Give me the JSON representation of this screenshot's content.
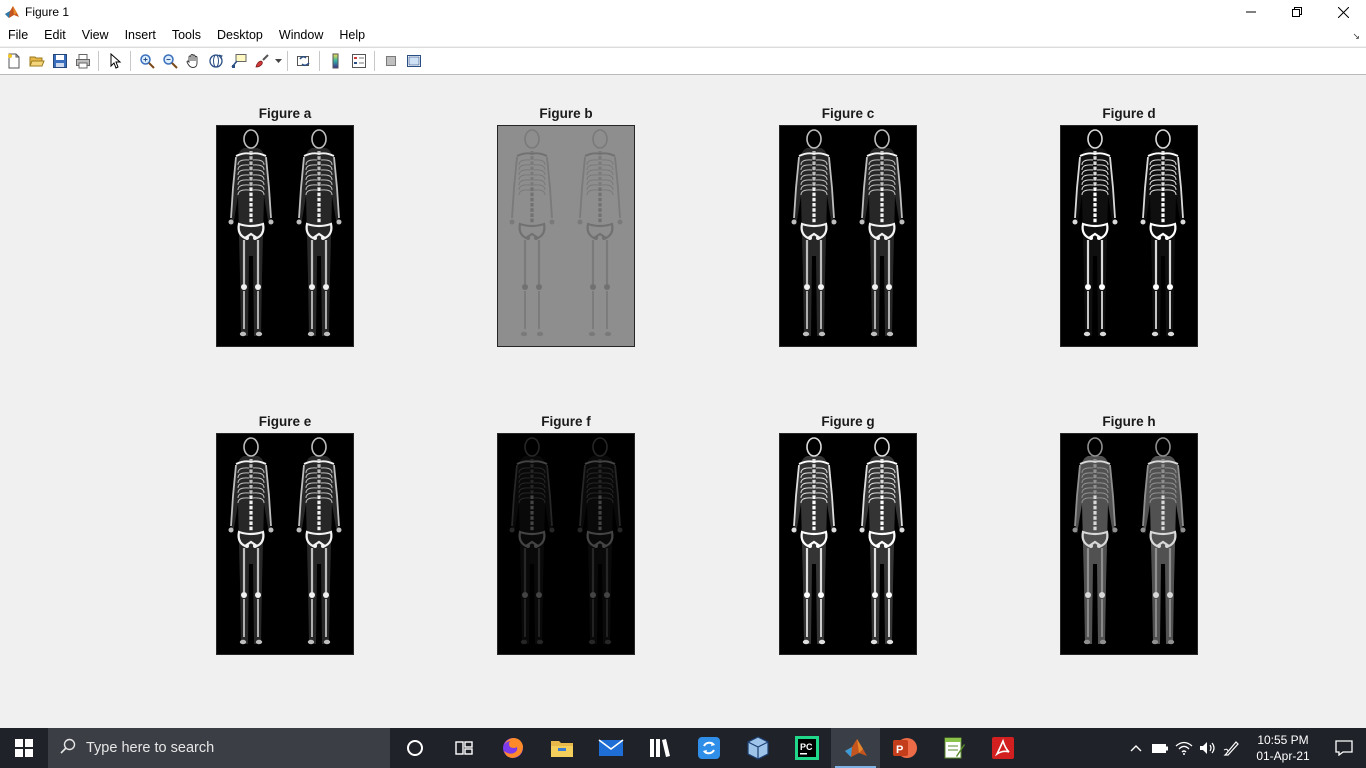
{
  "window": {
    "title": "Figure 1"
  },
  "menu": {
    "items": [
      "File",
      "Edit",
      "View",
      "Insert",
      "Tools",
      "Desktop",
      "Window",
      "Help"
    ]
  },
  "toolbar": {
    "icons": [
      "new-figure-icon",
      "open-file-icon",
      "save-icon",
      "print-icon",
      "select-pointer-icon",
      "zoom-in-icon",
      "zoom-out-icon",
      "pan-hand-icon",
      "rotate-3d-icon",
      "data-cursor-icon",
      "brush-icon",
      "link-plot-icon",
      "colorbar-icon",
      "legend-icon",
      "hide-plot-tools-icon",
      "show-plot-tools-icon"
    ]
  },
  "figure": {
    "subplots": [
      {
        "title": "Figure a",
        "style": "normal"
      },
      {
        "title": "Figure b",
        "style": "gray"
      },
      {
        "title": "Figure c",
        "style": "normal"
      },
      {
        "title": "Figure d",
        "style": "edges"
      },
      {
        "title": "Figure e",
        "style": "normal"
      },
      {
        "title": "Figure f",
        "style": "dark"
      },
      {
        "title": "Figure g",
        "style": "bright"
      },
      {
        "title": "Figure h",
        "style": "soft"
      }
    ]
  },
  "taskbar": {
    "search_placeholder": "Type here to search",
    "apps": [
      "cortana-icon",
      "task-view-icon",
      "firefox-icon",
      "file-explorer-icon",
      "mail-icon",
      "library-icon",
      "sync-icon",
      "virtualbox-icon",
      "pycharm-icon",
      "matlab-icon",
      "powerpoint-icon",
      "notepad-icon",
      "acrobat-icon"
    ],
    "time": "10:55 PM",
    "date": "01-Apr-21"
  },
  "colors": {
    "titlebar": "#ffffff",
    "figure_bg": "#f0f0f0",
    "taskbar": "#1f2329",
    "search_box": "#3b3f45",
    "active_indicator": "#7fb3e6"
  }
}
